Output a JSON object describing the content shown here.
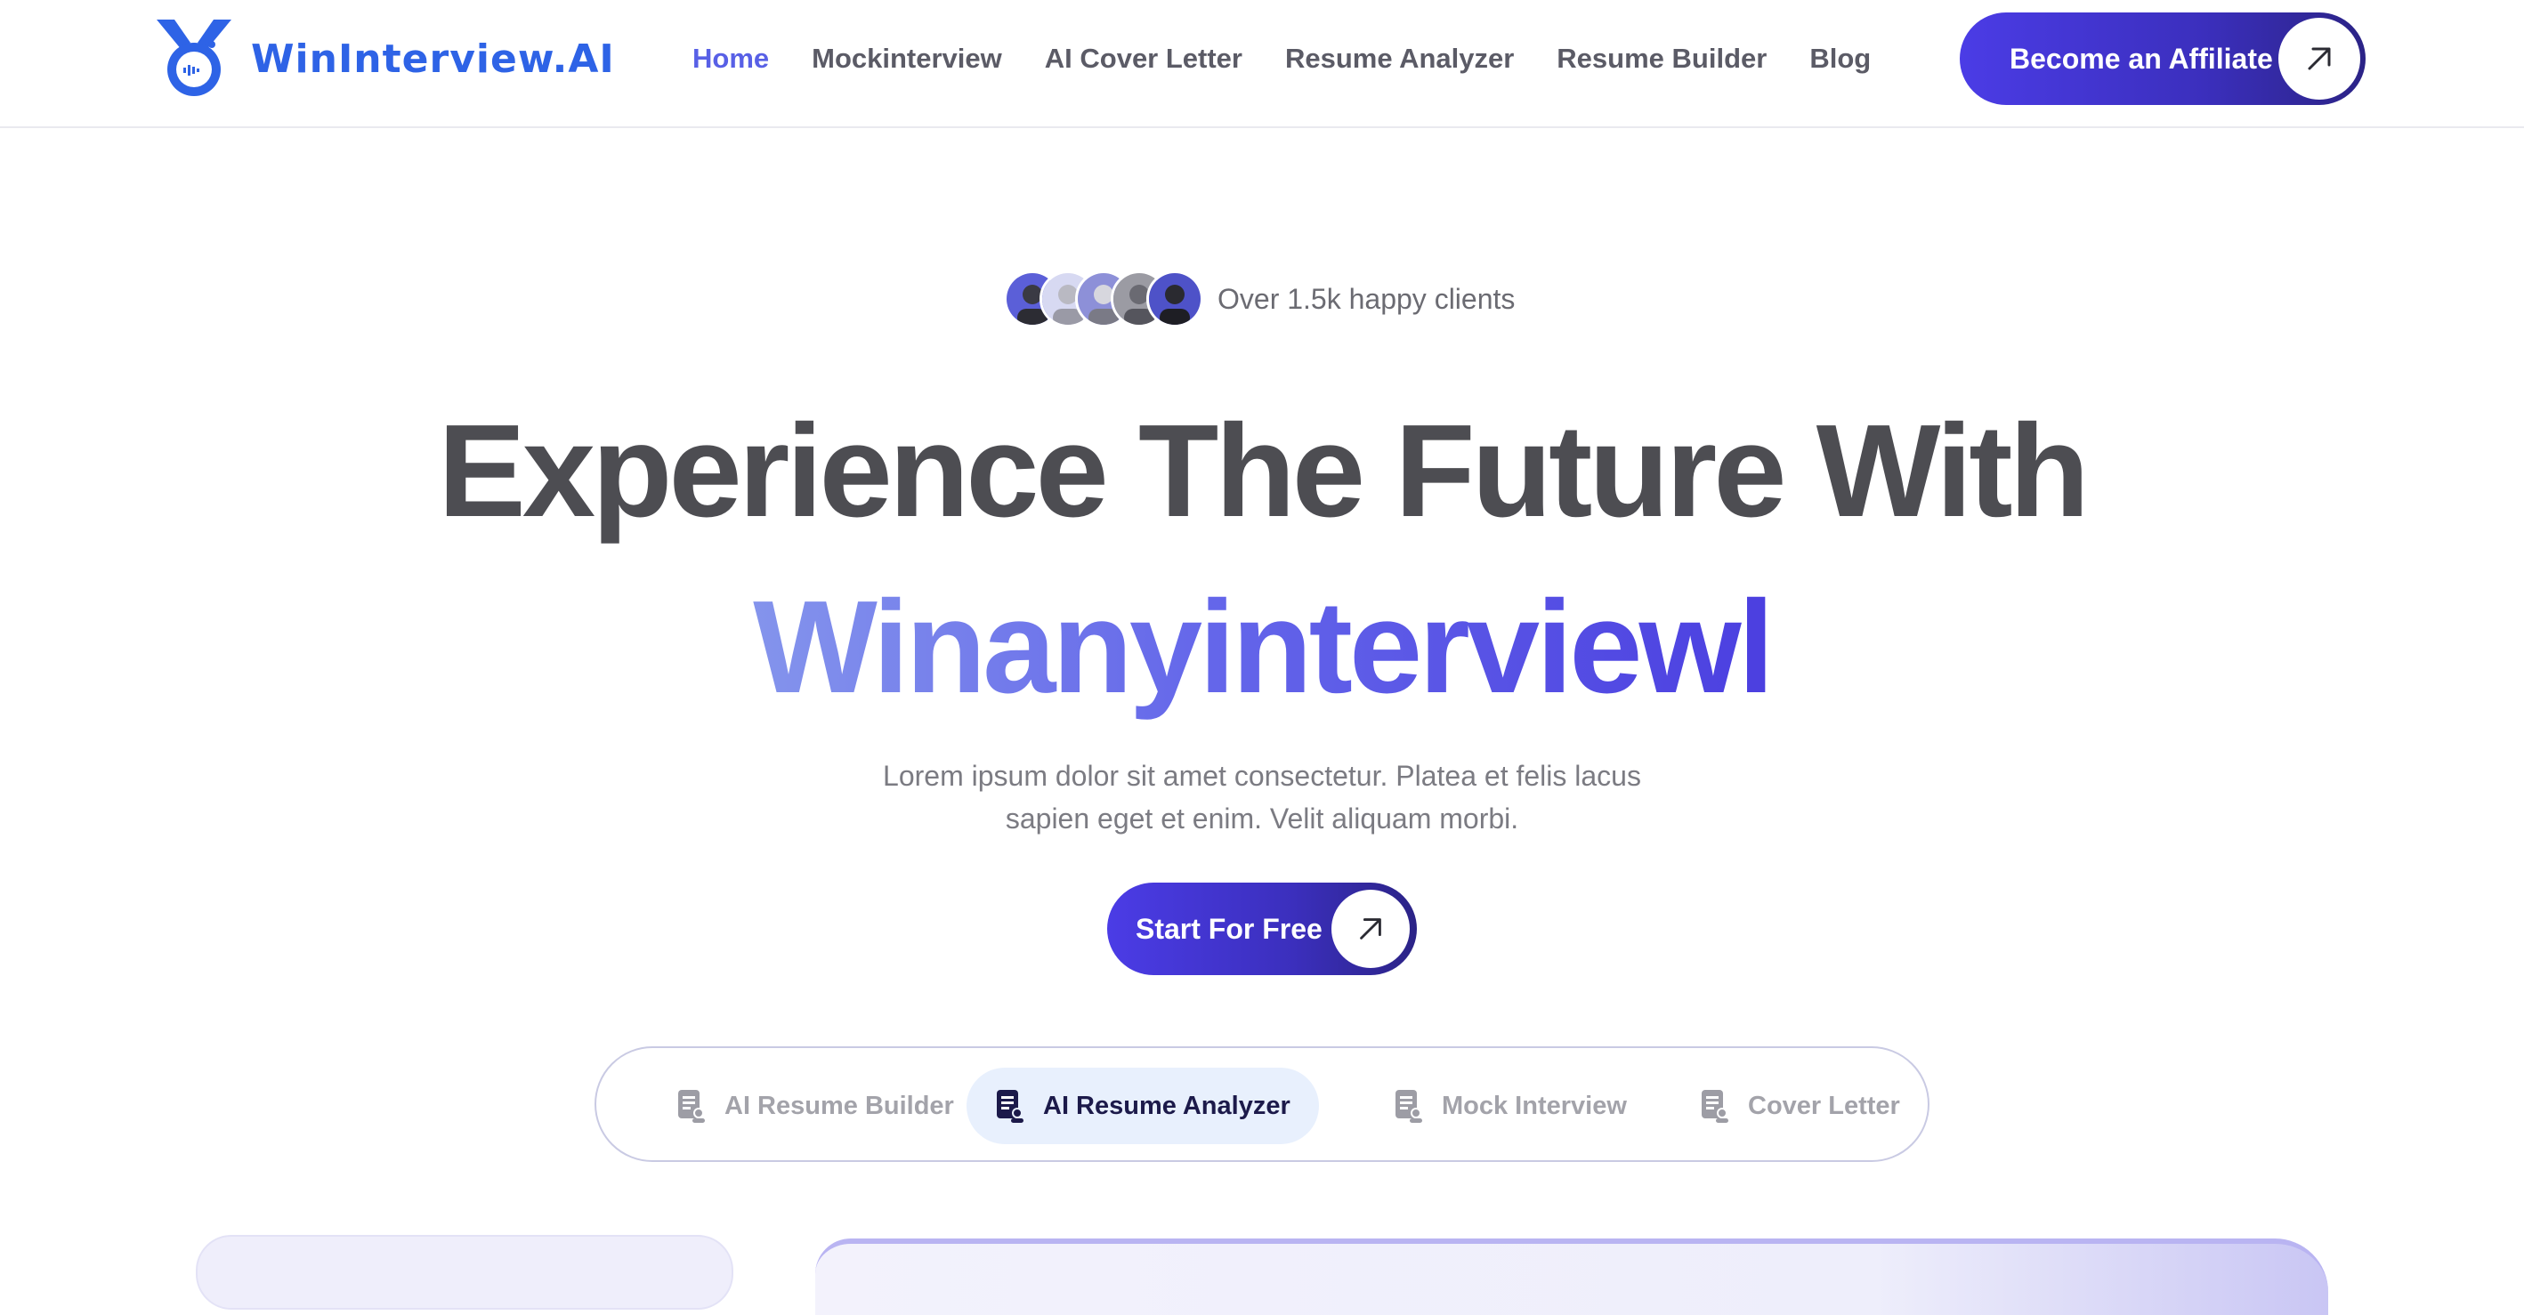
{
  "brand": {
    "name": "WinInterview.AI",
    "logo_icon": "medal-chat-logo"
  },
  "nav": {
    "items": [
      {
        "label": "Home",
        "active": true
      },
      {
        "label": "Mockinterview",
        "active": false
      },
      {
        "label": "AI Cover Letter",
        "active": false
      },
      {
        "label": "Resume Analyzer",
        "active": false
      },
      {
        "label": "Resume Builder",
        "active": false
      },
      {
        "label": "Blog",
        "active": false
      }
    ],
    "cta": {
      "label": "Become an Affiliate",
      "icon": "arrow-up-right-icon"
    }
  },
  "hero": {
    "clients_text": "Over 1.5k happy clients",
    "title_line1": "Experience The Future With",
    "title_line2": "Winanyinterviewl",
    "description": "Lorem ipsum dolor sit amet consectetur. Platea et felis lacus sapien eget et enim. Velit aliquam morbi.",
    "cta": {
      "label": "Start For Free",
      "icon": "arrow-up-right-icon"
    }
  },
  "tabs": [
    {
      "label": "AI Resume Builder",
      "icon": "document-user-icon",
      "active": false
    },
    {
      "label": "AI Resume Analyzer",
      "icon": "document-user-icon",
      "active": true
    },
    {
      "label": "Mock Interview",
      "icon": "document-user-icon",
      "active": false
    },
    {
      "label": "Cover Letter",
      "icon": "document-user-icon",
      "active": false
    }
  ],
  "colors": {
    "accent": "#5860e6",
    "brand_blue": "#2e63e6",
    "button_gradient_start": "#4b3ce6",
    "button_gradient_end": "#2b2386",
    "heading": "#4d4d52",
    "active_tab_bg": "#e8f0fd"
  }
}
